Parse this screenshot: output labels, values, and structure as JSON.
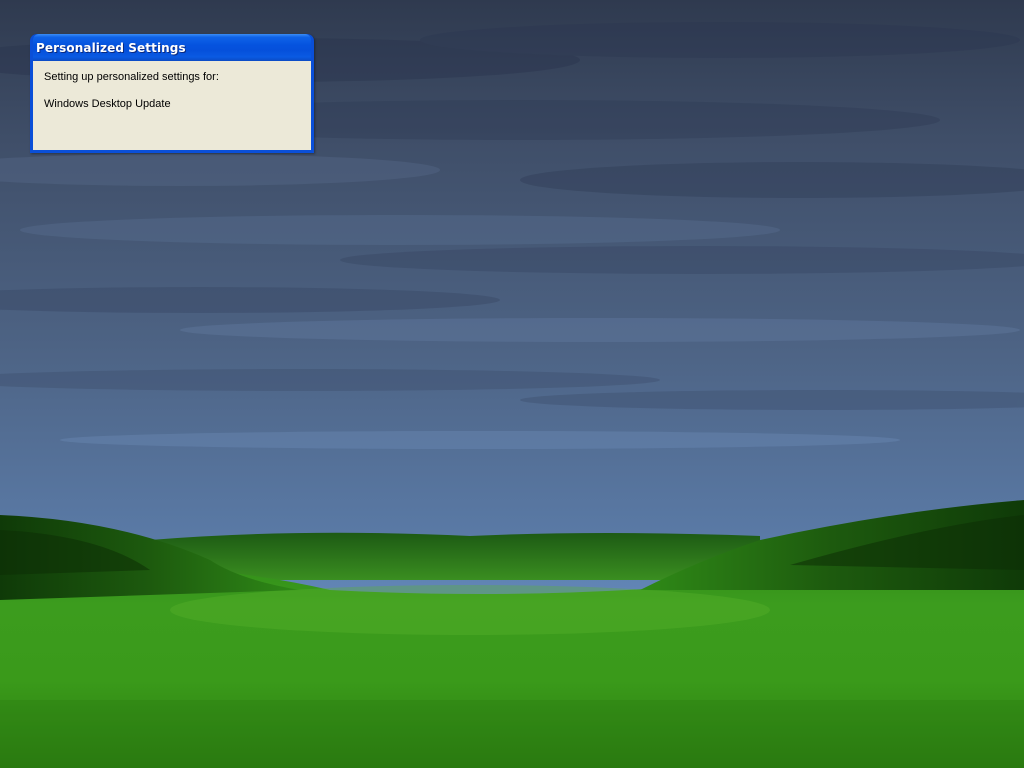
{
  "window": {
    "title": "Personalized Settings",
    "message": "Setting up personalized settings for:",
    "component": "Windows Desktop Update"
  },
  "colors": {
    "titlebar": "#0553df",
    "window_frame": "#0a4fd8",
    "client_background": "#ece9d8",
    "sky": "#4a5d7a",
    "grass": "#3c9a1c"
  },
  "icons": {
    "wallpaper": "bliss-style-landscape"
  }
}
